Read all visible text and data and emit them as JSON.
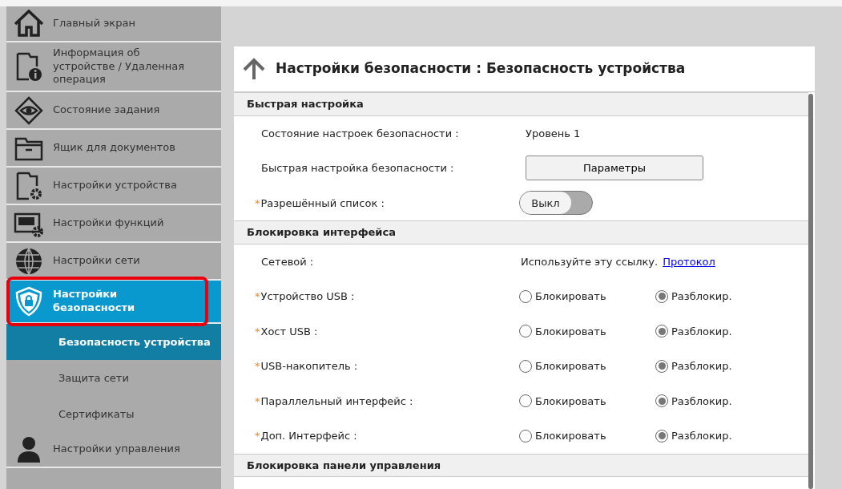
{
  "sidebar": {
    "items": [
      {
        "kind": "main",
        "label": "Главный экран",
        "selected": false,
        "highlighted": false
      },
      {
        "kind": "main",
        "label": "Информация об устройстве / Удаленная операция",
        "selected": false,
        "highlighted": false
      },
      {
        "kind": "main",
        "label": "Состояние задания",
        "selected": false,
        "highlighted": false
      },
      {
        "kind": "main",
        "label": "Ящик для документов",
        "selected": false,
        "highlighted": false
      },
      {
        "kind": "main",
        "label": "Настройки устройства",
        "selected": false,
        "highlighted": false
      },
      {
        "kind": "main",
        "label": "Настройки функций",
        "selected": false,
        "highlighted": false
      },
      {
        "kind": "main",
        "label": "Настройки сети",
        "selected": false,
        "highlighted": false
      },
      {
        "kind": "main",
        "label": "Настройки безопасности",
        "selected": true,
        "highlighted": true
      },
      {
        "kind": "sub",
        "label": "Безопасность устройства",
        "selected": true
      },
      {
        "kind": "sub",
        "label": "Защита сети",
        "selected": false
      },
      {
        "kind": "sub",
        "label": "Сертификаты",
        "selected": false
      },
      {
        "kind": "main",
        "label": "Настройки управления",
        "selected": false,
        "highlighted": false
      }
    ]
  },
  "page": {
    "title": "Настройки безопасности : Безопасность устройства",
    "sections": [
      {
        "title": "Быстрая настройка",
        "rows": [
          {
            "kind": "text",
            "label": "Состояние настроек безопасности :",
            "value": "Уровень 1"
          },
          {
            "kind": "button",
            "label": "Быстрая настройка безопасности :",
            "button": "Параметры"
          },
          {
            "kind": "toggle",
            "mark": "*",
            "label": "Разрешённый список :",
            "toggle": "Выкл",
            "on": false
          }
        ]
      },
      {
        "title": "Блокировка интерфейса",
        "rows": [
          {
            "kind": "link",
            "label": "Сетевой :",
            "value": "Используйте эту ссылку.",
            "link": "Протокол"
          },
          {
            "kind": "radio",
            "mark": "*",
            "label": "Устройство USB :",
            "options": [
              {
                "label": "Блокировать",
                "selected": false
              },
              {
                "label": "Разблокир.",
                "selected": true
              }
            ]
          },
          {
            "kind": "radio",
            "mark": "*",
            "label": "Хост USB :",
            "options": [
              {
                "label": "Блокировать",
                "selected": false
              },
              {
                "label": "Разблокир.",
                "selected": true
              }
            ]
          },
          {
            "kind": "radio",
            "mark": "*",
            "label": "USB-накопитель :",
            "options": [
              {
                "label": "Блокировать",
                "selected": false
              },
              {
                "label": "Разблокир.",
                "selected": true
              }
            ]
          },
          {
            "kind": "radio",
            "mark": "*",
            "label": "Параллельный интерфейс :",
            "options": [
              {
                "label": "Блокировать",
                "selected": false
              },
              {
                "label": "Разблокир.",
                "selected": true
              }
            ]
          },
          {
            "kind": "radio",
            "mark": "*",
            "label": "Доп. Интерфейс :",
            "options": [
              {
                "label": "Блокировать",
                "selected": false
              },
              {
                "label": "Разблокир.",
                "selected": true
              }
            ]
          }
        ]
      },
      {
        "title": "Блокировка панели управления"
      }
    ]
  }
}
